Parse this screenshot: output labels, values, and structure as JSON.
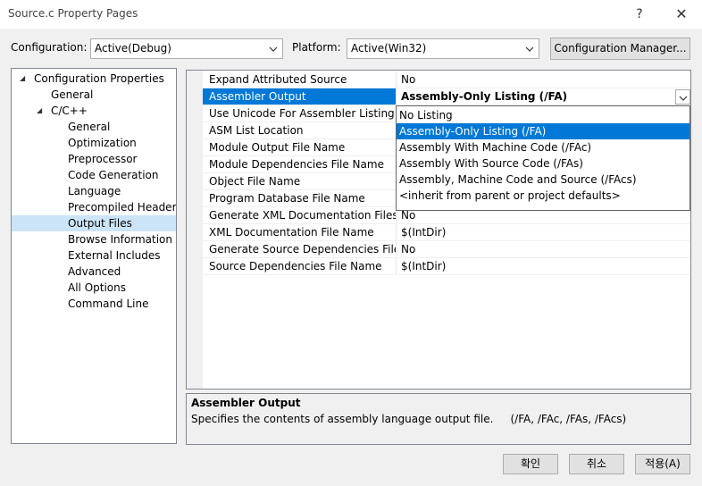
{
  "window": {
    "title": "Source.c Property Pages",
    "help": "?",
    "close": "✕"
  },
  "toolbar": {
    "configuration_label": "Configuration:",
    "configuration_value": "Active(Debug)",
    "platform_label": "Platform:",
    "platform_value": "Active(Win32)",
    "config_manager_label": "Configuration Manager..."
  },
  "tree": [
    {
      "label": "Configuration Properties",
      "expander": "◢",
      "selected": false
    },
    {
      "label": "General",
      "selected": false
    },
    {
      "label": "C/C++",
      "expander": "◢",
      "selected": false
    },
    {
      "label": "General",
      "selected": false
    },
    {
      "label": "Optimization",
      "selected": false
    },
    {
      "label": "Preprocessor",
      "selected": false
    },
    {
      "label": "Code Generation",
      "selected": false
    },
    {
      "label": "Language",
      "selected": false
    },
    {
      "label": "Precompiled Headers",
      "selected": false
    },
    {
      "label": "Output Files",
      "selected": true
    },
    {
      "label": "Browse Information",
      "selected": false
    },
    {
      "label": "External Includes",
      "selected": false
    },
    {
      "label": "Advanced",
      "selected": false
    },
    {
      "label": "All Options",
      "selected": false
    },
    {
      "label": "Command Line",
      "selected": false
    }
  ],
  "properties": [
    {
      "name": "Expand Attributed Source",
      "value": "No"
    },
    {
      "name": "Assembler Output",
      "value": "Assembly-Only Listing (/FA)",
      "selected": true
    },
    {
      "name": "Use Unicode For Assembler Listing",
      "value": ""
    },
    {
      "name": "ASM List Location",
      "value": ""
    },
    {
      "name": "Module Output File Name",
      "value": ""
    },
    {
      "name": "Module Dependencies File Name",
      "value": ""
    },
    {
      "name": "Object File Name",
      "value": ""
    },
    {
      "name": "Program Database File Name",
      "value": ""
    },
    {
      "name": "Generate XML Documentation Files",
      "value": "No"
    },
    {
      "name": "XML Documentation File Name",
      "value": "$(IntDir)"
    },
    {
      "name": "Generate Source Dependencies File",
      "value": "No"
    },
    {
      "name": "Source Dependencies File Name",
      "value": "$(IntDir)"
    }
  ],
  "dropdown_options": [
    {
      "label": "No Listing",
      "selected": false
    },
    {
      "label": "Assembly-Only Listing (/FA)",
      "selected": true
    },
    {
      "label": "Assembly With Machine Code (/FAc)",
      "selected": false
    },
    {
      "label": "Assembly With Source Code (/FAs)",
      "selected": false
    },
    {
      "label": "Assembly, Machine Code and Source (/FAcs)",
      "selected": false
    },
    {
      "label": "<inherit from parent or project defaults>",
      "selected": false
    }
  ],
  "description": {
    "title": "Assembler Output",
    "text": "Specifies the contents of assembly language output file.     (/FA, /FAc, /FAs, /FAcs)"
  },
  "buttons": {
    "ok": "확인",
    "cancel": "취소",
    "apply": "적용(A)"
  },
  "colors": {
    "selection": "#0078d7",
    "tree_selection": "#cce4f7"
  }
}
